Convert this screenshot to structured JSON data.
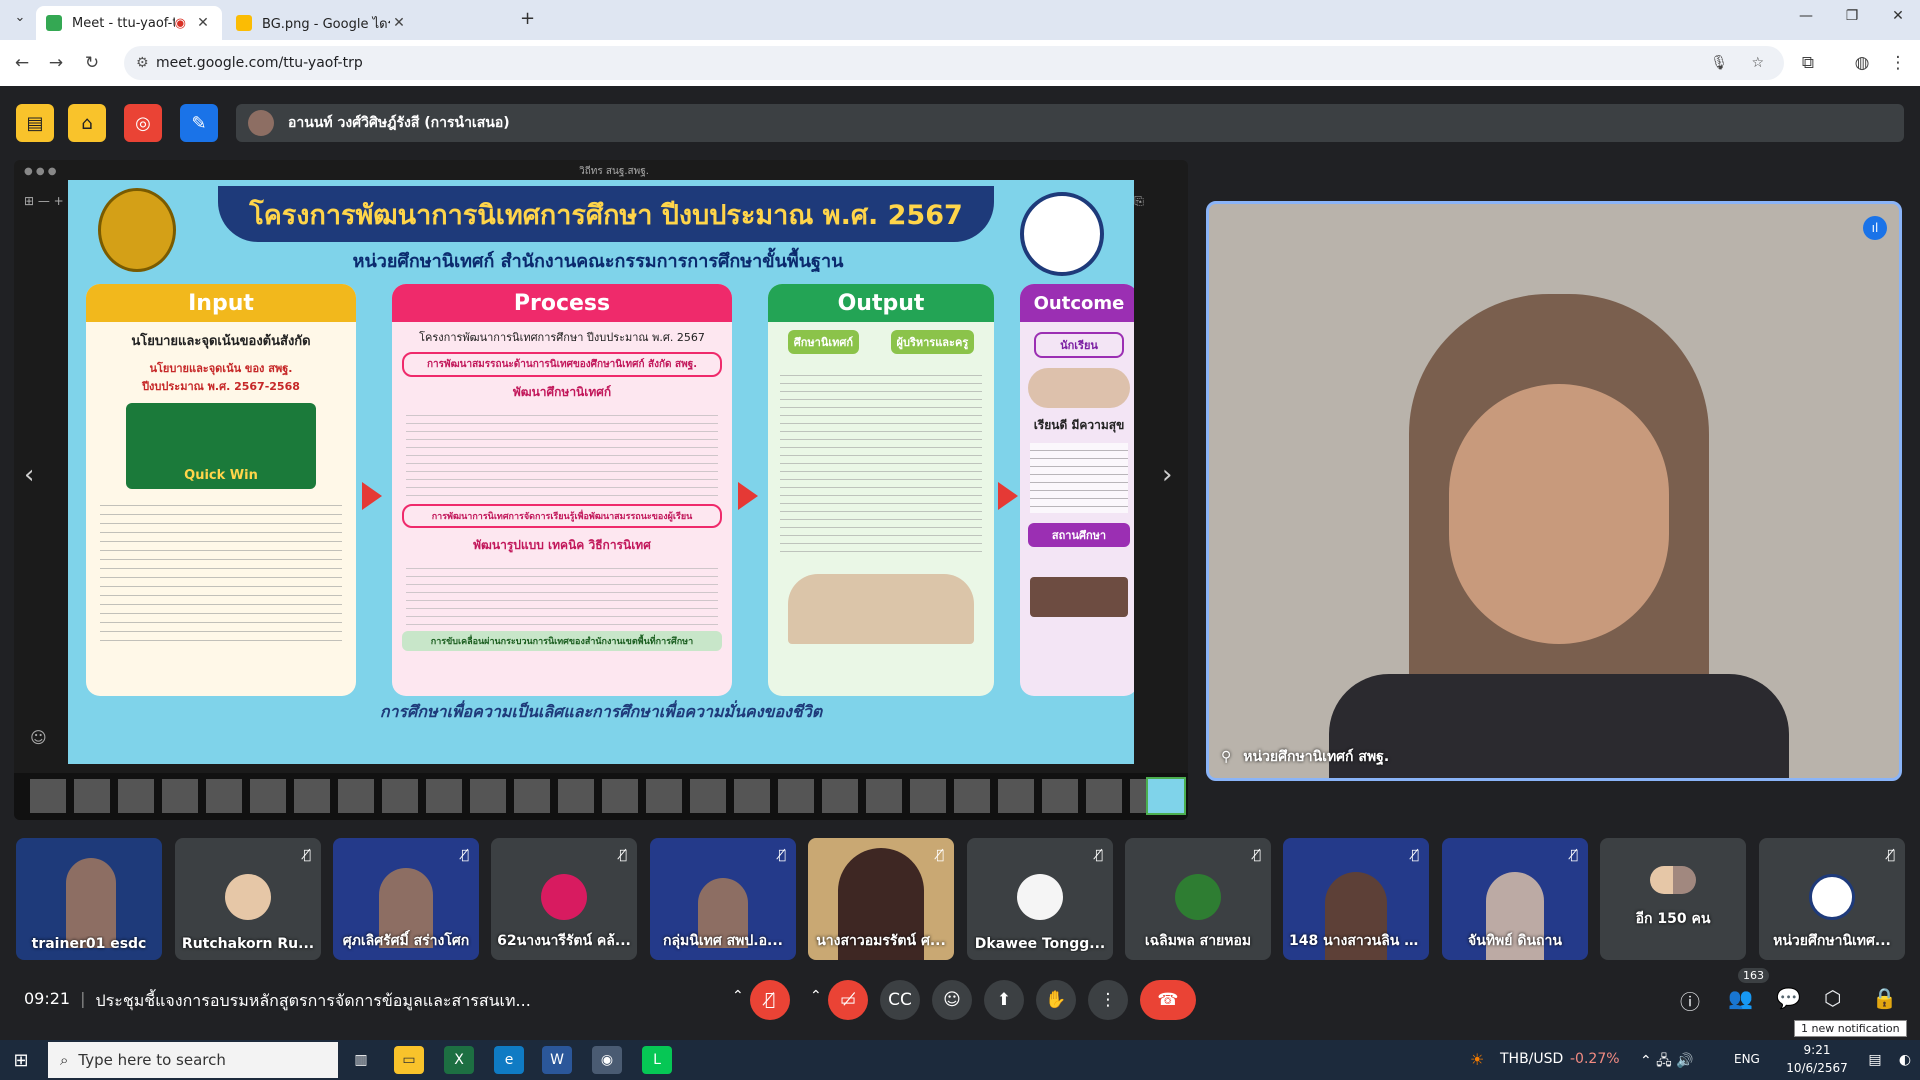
{
  "browser": {
    "tabs": [
      {
        "title": "Meet - ttu-yaof-trp",
        "active": true
      },
      {
        "title": "BG.png - Google ไดรฟ์",
        "active": false
      }
    ],
    "url": "meet.google.com/ttu-yaof-trp"
  },
  "meet": {
    "presenter_label": "อานนท์ วงศ์วิศิษฎ์รังสี (การนำเสนอ)",
    "slide": {
      "window_title": "วิถีทร สนฐ.สพฐ.",
      "title": "โครงการพัฒนาการนิเทศการศึกษา ปีงบประมาณ พ.ศ. 2567",
      "subtitle": "หน่วยศึกษานิเทศก์ สำนักงานคณะกรรมการการศึกษาขั้นพื้นฐาน",
      "columns": [
        {
          "head": "Input",
          "color": "#f2b81c",
          "line1": "นโยบายและจุดเน้นของต้นสังกัด",
          "line2": "นโยบายและจุดเน้น ของ สพฐ. ปีงบประมาณ พ.ศ. 2567-2568",
          "badge": "Quick Win"
        },
        {
          "head": "Process",
          "color": "#ef2a6b",
          "line1": "โครงการพัฒนาการนิเทศการศึกษา ปีงบประมาณ พ.ศ. 2567",
          "line2": "การพัฒนาสมรรถนะด้านการนิเทศของศึกษานิเทศก์ สังกัด สพฐ.",
          "line3": "พัฒนาศึกษานิเทศก์",
          "line4": "การพัฒนาการนิเทศการจัดการเรียนรู้เพื่อพัฒนาสมรรถนะของผู้เรียน",
          "line5": "พัฒนารูปแบบ เทคนิค วิธีการนิเทศ",
          "line6": "การขับเคลื่อนผ่านกระบวนการนิเทศของสำนักงานเขตพื้นที่การศึกษา"
        },
        {
          "head": "Output",
          "color": "#23a455",
          "line1": "ศึกษานิเทศก์",
          "line2": "ผู้บริหารและครู"
        },
        {
          "head": "Outcome",
          "color": "#9b2fb3",
          "line1": "นักเรียน",
          "line2": "เรียนดี มีความสุข",
          "line3": "สถานศึกษา"
        }
      ],
      "footer": "การศึกษาเพื่อความเป็นเลิศและการศึกษาเพื่อความมั่นคงของชีวิต"
    },
    "speaker_name": "หน่วยศึกษานิเทศก์ สพฐ.",
    "participants": [
      {
        "name": "trainer01 esdc"
      },
      {
        "name": "Rutchakorn Ru..."
      },
      {
        "name": "ศุภเลิศรัศมิ์ สร่างโศก"
      },
      {
        "name": "62นางนารีรัตน์ คล้..."
      },
      {
        "name": "กลุ่มนิเทศ สพป.อ..."
      },
      {
        "name": "นางสาวอมรรัตน์ ศ..."
      },
      {
        "name": "Dkawee Tongg..."
      },
      {
        "name": "เฉลิมพล สายหอม"
      },
      {
        "name": "148 นางสาวนลิน เ..."
      },
      {
        "name": "จันทิพย์ ดินถาน"
      },
      {
        "name": "อีก 150 คน"
      },
      {
        "name": "หน่วยศึกษานิเทศ..."
      }
    ],
    "time": "09:21",
    "meeting_title": "ประชุมชี้แจงการอบรมหลักสูตรการจัดการข้อมูลและสารสนเท...",
    "participant_count": "163",
    "notification": "1 new notification"
  },
  "taskbar": {
    "search_placeholder": "Type here to search",
    "ticker": "THB/USD",
    "ticker_change": "-0.27%",
    "lang": "ENG",
    "clock_time": "9:21",
    "clock_date": "10/6/2567"
  }
}
